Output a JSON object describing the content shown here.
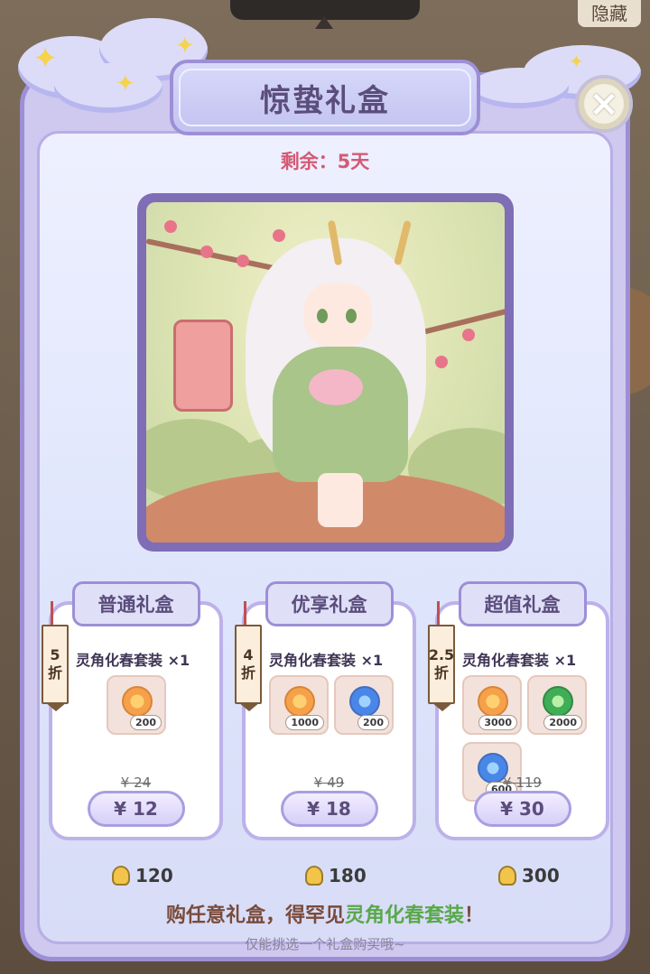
{
  "background": {
    "hidden_button": "隐藏"
  },
  "header": {
    "title": "惊蛰礼盒",
    "close_label": "×"
  },
  "remaining": "剩余：5天",
  "cards": [
    {
      "title": "普通礼盒",
      "discount_num": "5",
      "discount_unit": "折",
      "item": "灵角化春套装 ×1",
      "rewards": [
        {
          "icon": "gold-clover-coin-icon",
          "amount": "200"
        }
      ],
      "original_price": "¥ 24",
      "price": "¥ 12",
      "bonus": "120"
    },
    {
      "title": "优享礼盒",
      "discount_num": "4",
      "discount_unit": "折",
      "item": "灵角化春套装 ×1",
      "rewards": [
        {
          "icon": "gold-clover-coin-icon",
          "amount": "1000"
        },
        {
          "icon": "blue-swirl-coin-icon",
          "amount": "200"
        }
      ],
      "original_price": "¥ 49",
      "price": "¥ 18",
      "bonus": "180"
    },
    {
      "title": "超值礼盒",
      "discount_num": "2.5",
      "discount_unit": "折",
      "item": "灵角化春套装 ×1",
      "rewards": [
        {
          "icon": "gold-clover-coin-icon",
          "amount": "3000"
        },
        {
          "icon": "green-clover-coin-icon",
          "amount": "2000"
        },
        {
          "icon": "blue-swirl-coin-icon",
          "amount": "600"
        }
      ],
      "original_price": "¥ 119",
      "price": "¥ 30",
      "bonus": "300"
    }
  ],
  "footer": {
    "main_prefix": "购任意礼盒，得罕见",
    "main_highlight": "灵角化春套装",
    "main_suffix": "！",
    "sub": "仅能挑选一个礼盒购买哦~"
  },
  "colors": {
    "accent": "#9d8fd6",
    "title_text": "#5b4d7c",
    "remaining_text": "#d45a74",
    "highlight_text": "#5aa84a"
  }
}
